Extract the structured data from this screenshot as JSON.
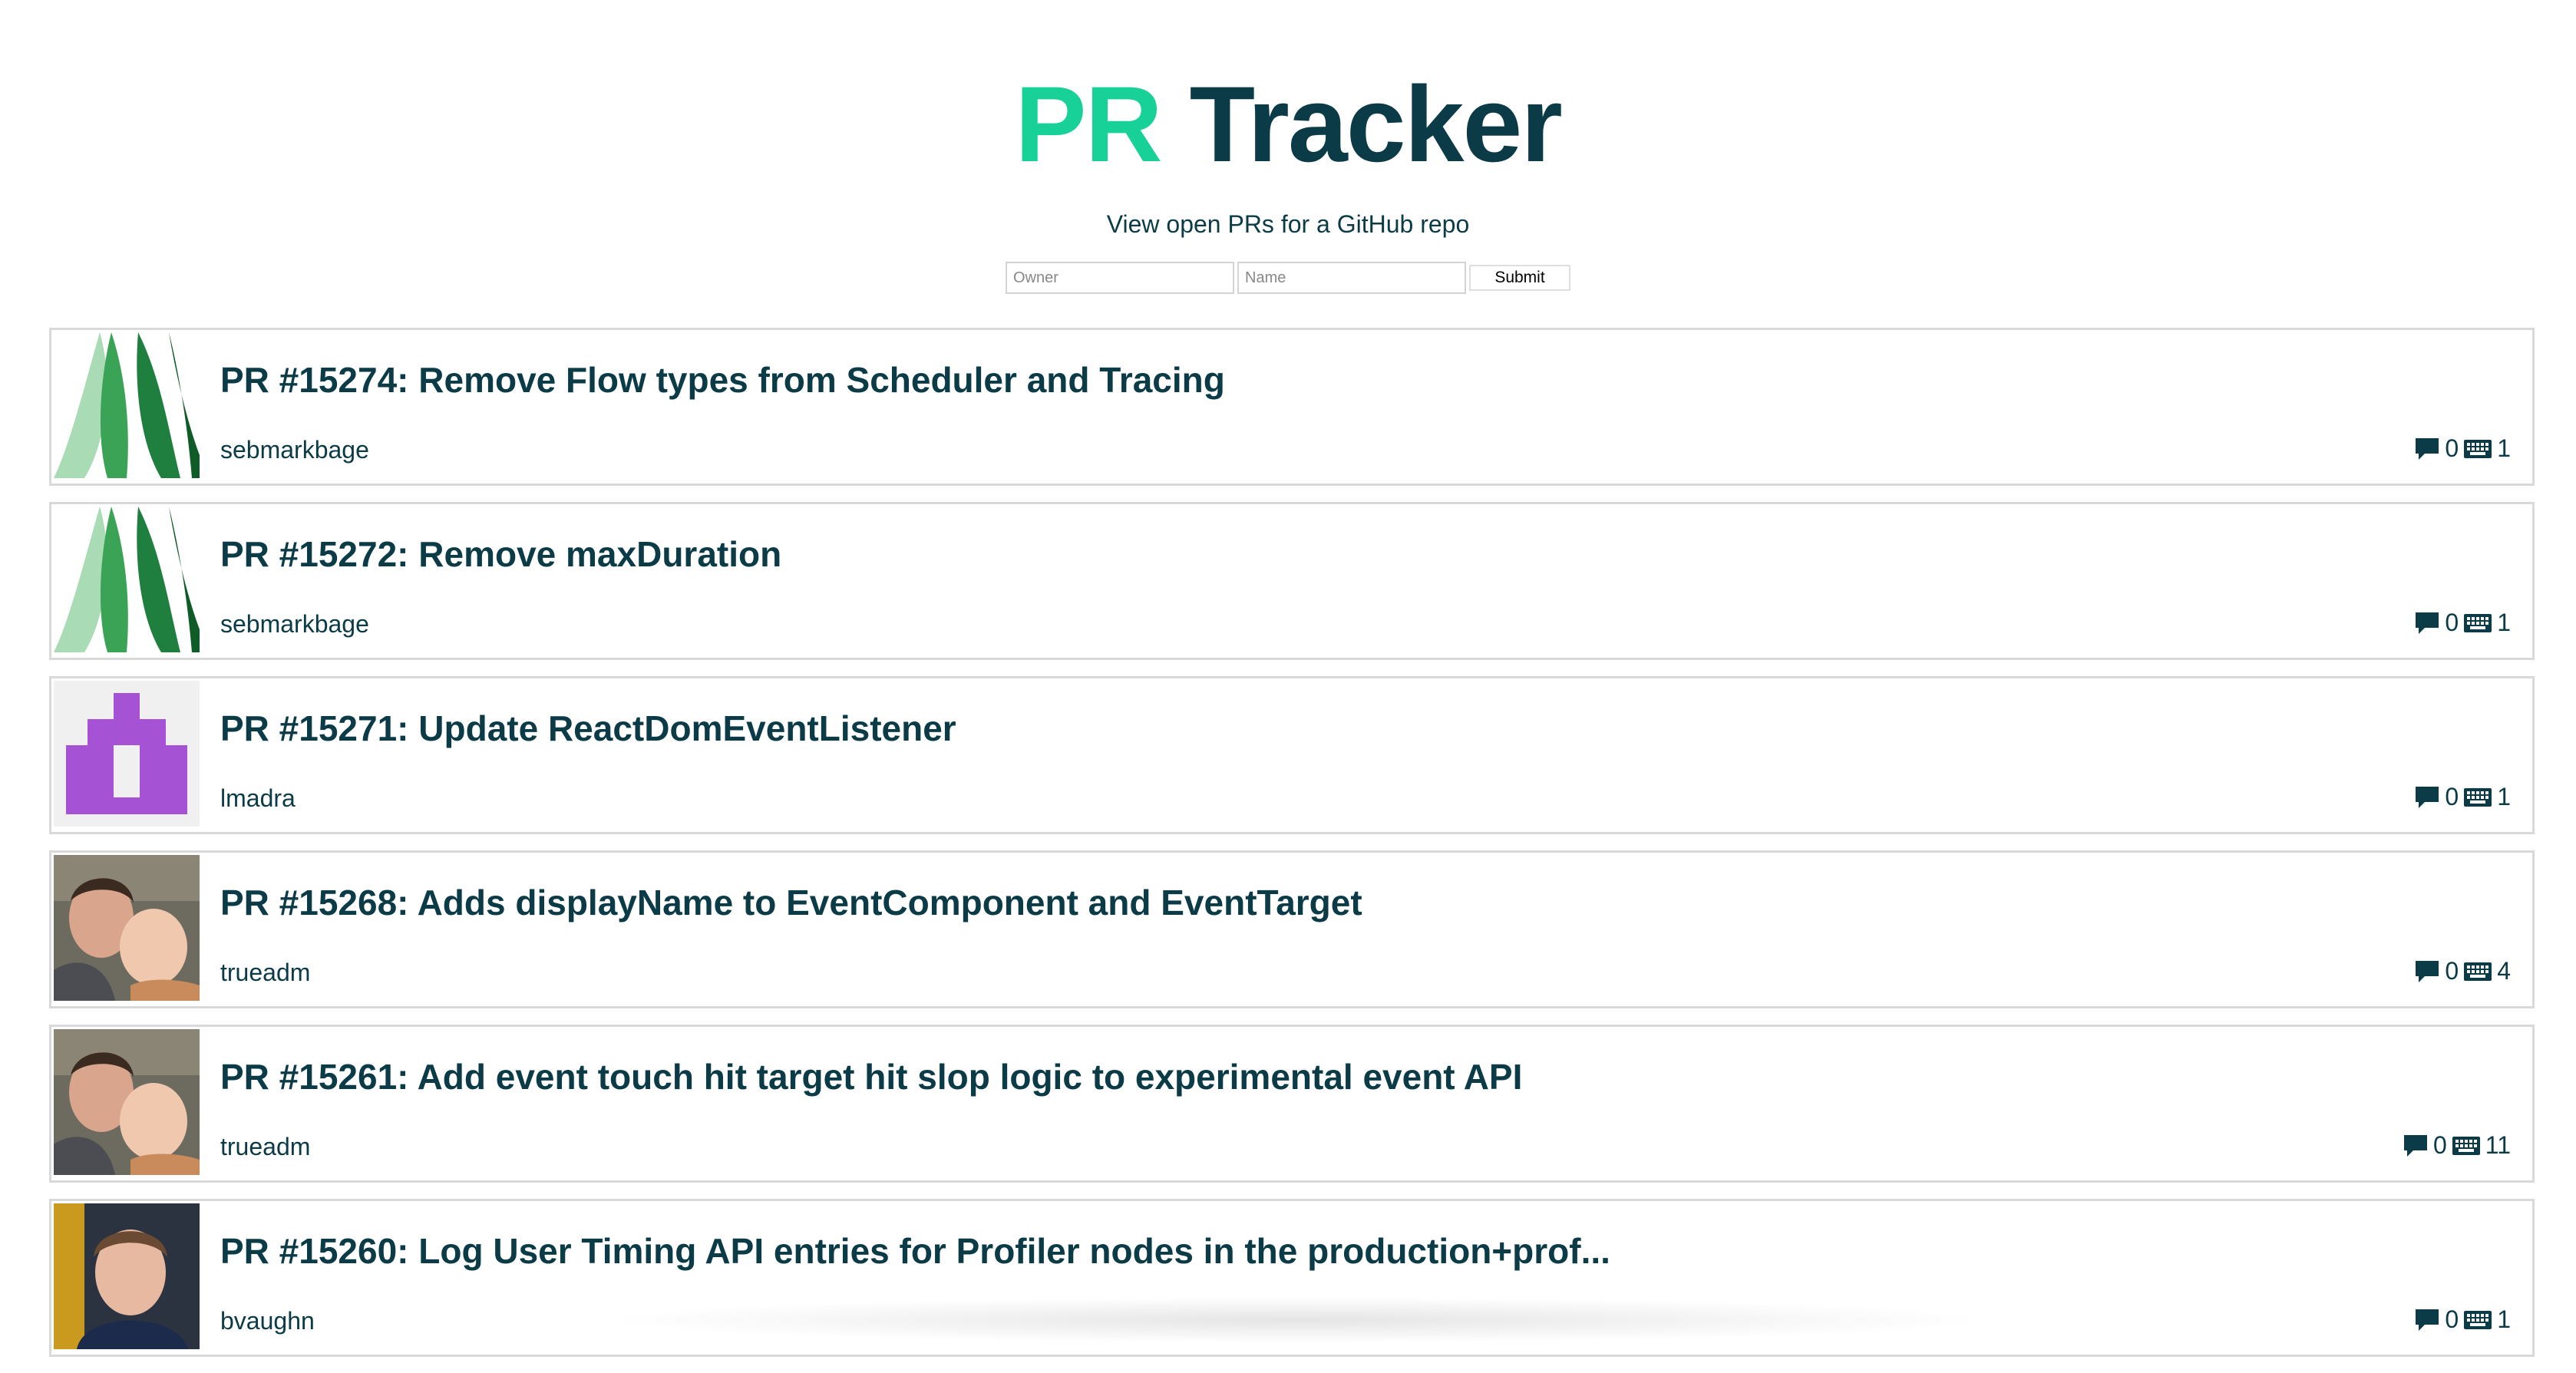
{
  "header": {
    "title_accent": "PR",
    "title_rest": "Tracker",
    "subtitle": "View open PRs for a GitHub repo"
  },
  "form": {
    "owner_placeholder": "Owner",
    "name_placeholder": "Name",
    "owner_value": "",
    "name_value": "",
    "submit_label": "Submit"
  },
  "icons": {
    "comment": "comment-icon",
    "commits": "keyboard-icon"
  },
  "colors": {
    "accent": "#18d198",
    "text": "#0b3b47",
    "border": "#d9d9d9"
  },
  "prs": [
    {
      "title": "PR #15274: Remove Flow types from Scheduler and Tracing",
      "author": "sebmarkbage",
      "comments": "0",
      "commits": "1",
      "avatar": "leaves"
    },
    {
      "title": "PR #15272: Remove maxDuration",
      "author": "sebmarkbage",
      "comments": "0",
      "commits": "1",
      "avatar": "leaves"
    },
    {
      "title": "PR #15271: Update ReactDomEventListener",
      "author": "lmadra",
      "comments": "0",
      "commits": "1",
      "avatar": "identicon"
    },
    {
      "title": "PR #15268: Adds displayName to EventComponent and EventTarget",
      "author": "trueadm",
      "comments": "0",
      "commits": "4",
      "avatar": "photo-two-faces"
    },
    {
      "title": "PR #15261: Add event touch hit target hit slop logic to experimental event API",
      "author": "trueadm",
      "comments": "0",
      "commits": "11",
      "avatar": "photo-two-faces"
    },
    {
      "title": "PR #15260: Log User Timing API entries for Profiler nodes in the production+prof...",
      "author": "bvaughn",
      "comments": "0",
      "commits": "1",
      "avatar": "photo-portrait"
    }
  ]
}
